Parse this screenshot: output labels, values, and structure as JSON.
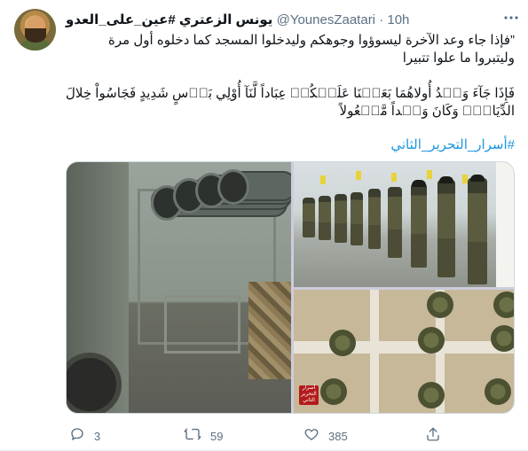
{
  "tweet": {
    "author_name": "يونس الزعتري #عين_على_العدو",
    "handle": "@YounesZaatari",
    "separator": "·",
    "time": "10h",
    "more_icon": "more-icon",
    "text_line1": "”فإذا جاء وعد الآخرة ليسوؤوا وجوهكم وليدخلوا المسجد كما دخلوه أول مرة وليتبروا ما علوا تتبيرا",
    "text_line2": "فَإِذَا جَآءَ وَعۡدُ أُولاهُمَا بَعَثۡنَا عَلَيۡكُمۡ عِبَاداً لَّنَآ أُوْلِي بَأۡسٍ شَدِيدٍ فَجَاسُواْ خِلالَ الدِّيَارِۚ وَكَانَ وَعۡداً مَّفۡعُولاً",
    "hashtag": "#أسرار_التحرير_الثاني",
    "watermark": "أسرار التحرير الثاني"
  },
  "actions": {
    "reply": {
      "icon": "reply-icon",
      "count": "3"
    },
    "retweet": {
      "icon": "retweet-icon",
      "count": "59"
    },
    "like": {
      "icon": "heart-icon",
      "count": "385"
    },
    "share": {
      "icon": "share-icon",
      "count": ""
    }
  },
  "colors": {
    "text": "#0f1419",
    "muted": "#5b7083",
    "link": "#1b95e0",
    "border": "#cfd9de"
  }
}
